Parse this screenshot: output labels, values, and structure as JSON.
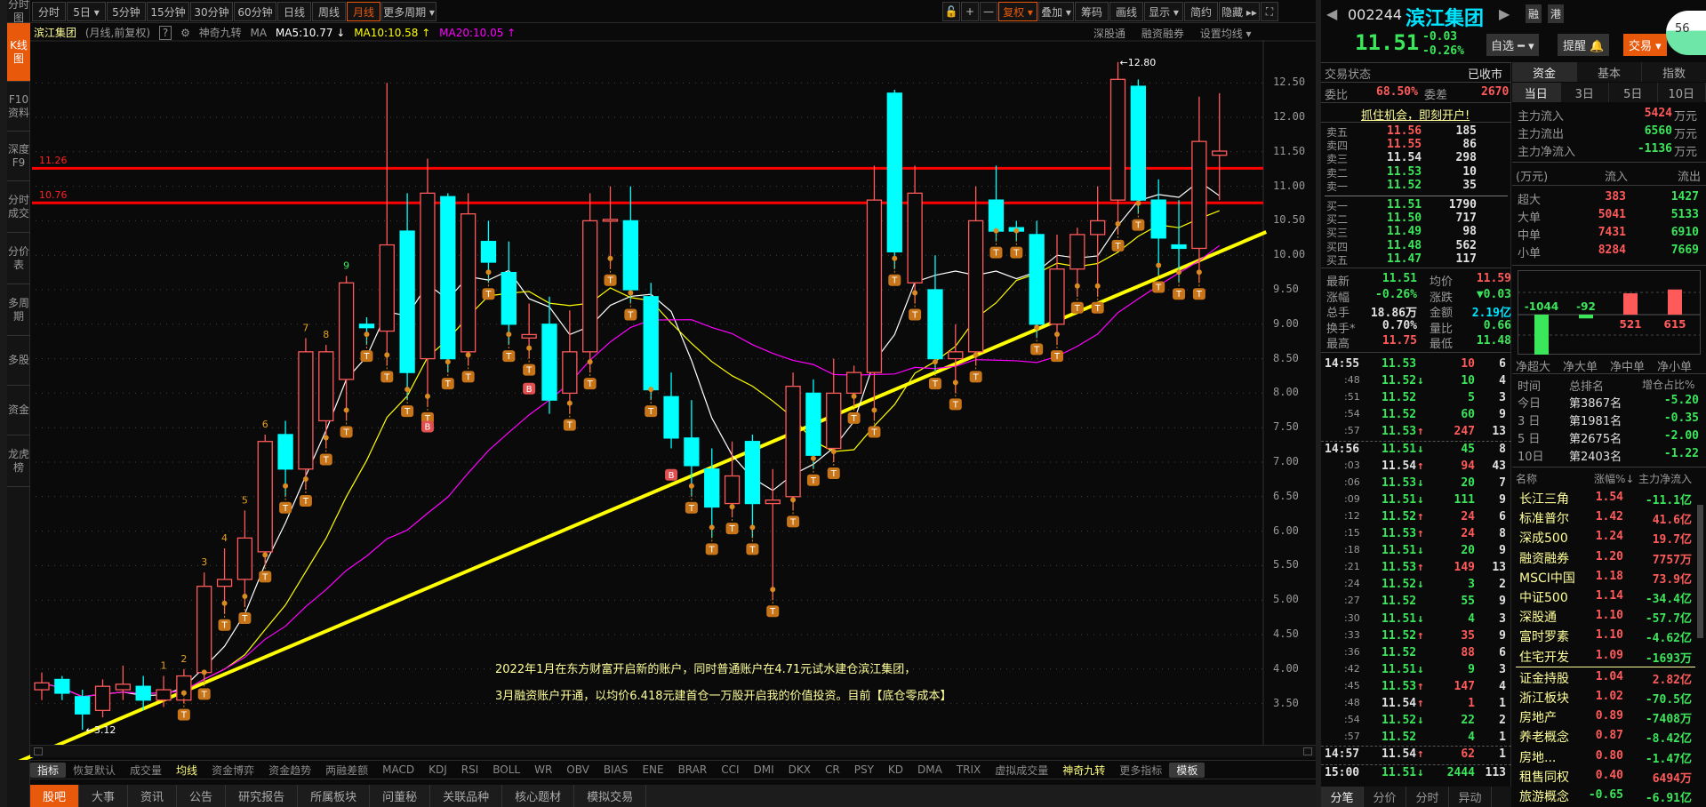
{
  "sidebar": {
    "items": [
      {
        "label": "分时图"
      },
      {
        "label": "K线图",
        "active": true
      },
      {
        "label": "F10资料"
      },
      {
        "label": "深度F9"
      },
      {
        "label": "分时成交"
      },
      {
        "label": "分价表"
      },
      {
        "label": "多周期"
      },
      {
        "label": "多股"
      },
      {
        "label": "资金"
      },
      {
        "label": "龙虎榜"
      }
    ]
  },
  "toolbar": {
    "periods": [
      {
        "label": "分时"
      },
      {
        "label": "5日 ▾"
      },
      {
        "label": "5分钟"
      },
      {
        "label": "15分钟"
      },
      {
        "label": "30分钟"
      },
      {
        "label": "60分钟"
      },
      {
        "label": "日线"
      },
      {
        "label": "周线"
      },
      {
        "label": "月线",
        "active": true
      },
      {
        "label": "更多周期 ▾"
      }
    ],
    "tools": [
      {
        "label": "🔓"
      },
      {
        "label": "+"
      },
      {
        "label": "—"
      },
      {
        "label": "复权 ▾",
        "active": true
      },
      {
        "label": "叠加 ▾"
      },
      {
        "label": "筹码"
      },
      {
        "label": "画线"
      },
      {
        "label": "显示 ▾"
      },
      {
        "label": "简约"
      },
      {
        "label": "隐藏 ▸▸"
      },
      {
        "label": "⛶"
      }
    ]
  },
  "legend": {
    "name": "滨江集团",
    "mode": "(月线,前复权)",
    "help": "?",
    "indicator": "神奇九转",
    "ma": "MA",
    "ma5": "MA5:10.77 ↓",
    "ma10": "MA10:10.58 ↑",
    "ma20": "MA20:10.05 ↑"
  },
  "chart_links": {
    "sgt": "深股通",
    "rzrq": "融资融券",
    "setma": "设置均线 ▾"
  },
  "colors": {
    "up": "#ff5a5a",
    "down": "#00ffff",
    "ma5": "#ffffff",
    "ma10": "#ffff00",
    "ma20": "#ff00ff",
    "accent": "#e8590c",
    "green": "#3ce65a"
  },
  "chart_data": {
    "type": "candlestick",
    "ylim": [
      3.2,
      12.9
    ],
    "yticks": [
      "12.50",
      "12.00",
      "11.50",
      "11.00",
      "10.50",
      "10.00",
      "9.50",
      "9.00",
      "8.50",
      "8.00",
      "7.50",
      "7.00",
      "6.50",
      "6.00",
      "5.50",
      "5.00",
      "4.50",
      "4.00",
      "3.50"
    ],
    "ohlc": [
      [
        3.7,
        3.95,
        3.55,
        3.8
      ],
      [
        3.85,
        3.9,
        3.55,
        3.65
      ],
      [
        3.6,
        3.7,
        3.12,
        3.35
      ],
      [
        3.4,
        3.85,
        3.3,
        3.75
      ],
      [
        3.7,
        4.05,
        3.55,
        3.78
      ],
      [
        3.75,
        3.9,
        3.4,
        3.55
      ],
      [
        3.55,
        3.9,
        3.45,
        3.7
      ],
      [
        3.55,
        4.0,
        3.5,
        3.9
      ],
      [
        3.95,
        5.4,
        3.8,
        5.2
      ],
      [
        5.2,
        5.75,
        4.8,
        5.3
      ],
      [
        5.3,
        6.3,
        4.9,
        5.9
      ],
      [
        5.7,
        7.4,
        5.5,
        7.3
      ],
      [
        7.4,
        7.6,
        6.5,
        6.9
      ],
      [
        6.9,
        8.8,
        6.6,
        8.6
      ],
      [
        7.6,
        8.7,
        7.2,
        8.6
      ],
      [
        8.2,
        9.7,
        7.6,
        9.6
      ],
      [
        9.0,
        9.1,
        8.7,
        8.95
      ],
      [
        8.9,
        12.5,
        8.4,
        10.15
      ],
      [
        10.35,
        10.9,
        7.9,
        8.3
      ],
      [
        8.5,
        11.4,
        7.8,
        10.9
      ],
      [
        10.85,
        10.9,
        8.3,
        8.5
      ],
      [
        8.6,
        10.9,
        8.4,
        10.6
      ],
      [
        10.2,
        10.5,
        9.6,
        9.9
      ],
      [
        9.75,
        10.2,
        8.7,
        9.0
      ],
      [
        8.8,
        9.3,
        8.5,
        8.85
      ],
      [
        9.0,
        9.4,
        7.7,
        7.9
      ],
      [
        8.0,
        9.2,
        7.7,
        8.6
      ],
      [
        8.6,
        10.9,
        8.3,
        10.5
      ],
      [
        10.5,
        11.0,
        9.8,
        10.52
      ],
      [
        10.5,
        11.0,
        9.3,
        9.5
      ],
      [
        9.4,
        9.6,
        7.9,
        8.05
      ],
      [
        7.95,
        8.3,
        7.2,
        7.35
      ],
      [
        7.35,
        7.9,
        6.5,
        6.95
      ],
      [
        6.9,
        7.2,
        5.9,
        6.35
      ],
      [
        6.4,
        7.3,
        6.2,
        6.8
      ],
      [
        7.3,
        7.4,
        5.9,
        6.4
      ],
      [
        6.4,
        6.9,
        5.0,
        6.45
      ],
      [
        6.5,
        8.3,
        6.3,
        8.1
      ],
      [
        8.0,
        8.2,
        6.9,
        7.1
      ],
      [
        7.2,
        8.5,
        7.0,
        8.0
      ],
      [
        8.0,
        8.4,
        7.8,
        8.3
      ],
      [
        8.3,
        11.3,
        7.6,
        10.8
      ],
      [
        12.35,
        12.4,
        9.8,
        10.05
      ],
      [
        9.6,
        11.3,
        9.3,
        10.9
      ],
      [
        9.5,
        10.0,
        8.3,
        8.5
      ],
      [
        8.5,
        9.0,
        8.0,
        8.6
      ],
      [
        8.6,
        11.0,
        8.4,
        10.5
      ],
      [
        10.8,
        11.3,
        10.2,
        10.35
      ],
      [
        10.4,
        10.5,
        10.2,
        10.35
      ],
      [
        10.3,
        10.5,
        8.8,
        9.0
      ],
      [
        9.0,
        10.3,
        8.7,
        9.8
      ],
      [
        9.8,
        10.4,
        9.4,
        10.3
      ],
      [
        10.3,
        11.0,
        9.4,
        10.5
      ],
      [
        10.8,
        12.8,
        10.3,
        12.55
      ],
      [
        12.45,
        12.55,
        10.6,
        10.8
      ],
      [
        10.8,
        11.1,
        9.7,
        10.25
      ],
      [
        10.15,
        10.8,
        9.6,
        10.1
      ],
      [
        10.1,
        12.3,
        9.6,
        11.65
      ],
      [
        11.45,
        12.35,
        10.8,
        11.51
      ]
    ],
    "hlines": [
      {
        "label": "11.26",
        "value": 11.26
      },
      {
        "label": "10.76",
        "value": 10.76
      }
    ],
    "trendline": [
      [
        2,
        3.05
      ],
      [
        58,
        10.05
      ]
    ],
    "annotations": {
      "high": "←12.80",
      "low": "←3.12"
    },
    "nine_counts": [
      {
        "i": 6,
        "label": "1"
      },
      {
        "i": 7,
        "label": "2"
      },
      {
        "i": 8,
        "label": "3"
      },
      {
        "i": 9,
        "label": "4"
      },
      {
        "i": 10,
        "label": "5"
      },
      {
        "i": 11,
        "label": "6"
      },
      {
        "i": 13,
        "label": "7"
      },
      {
        "i": 14,
        "label": "8"
      },
      {
        "i": 15,
        "label": "9"
      }
    ],
    "t_markers": [
      7,
      8,
      9,
      10,
      11,
      12,
      13,
      14,
      15,
      16,
      17,
      18,
      19,
      20,
      21,
      22,
      23,
      24,
      26,
      27,
      28,
      29,
      30,
      32,
      33,
      34,
      35,
      36,
      37,
      38,
      39,
      40,
      41,
      42,
      43,
      44,
      45,
      46,
      47,
      48,
      49,
      50,
      51,
      52,
      53,
      54,
      55,
      56,
      57
    ],
    "t_label": "T",
    "b_markers": [
      {
        "i": 19,
        "p": 7.6
      },
      {
        "i": 24,
        "p": 8.15
      },
      {
        "i": 31,
        "p": 6.9
      }
    ],
    "b_label": "B"
  },
  "note": {
    "line1": "2022年1月在东方财富开启新的账户，同时普通账户在4.71元试水建仓滨江集团，",
    "line2": "3月融资账户开通，以均价6.418元建首仓一万股开启我的价值投资。目前【底仓零成本】"
  },
  "indicators": [
    {
      "label": "指标",
      "box": true
    },
    {
      "label": "恢复默认"
    },
    {
      "label": "成交量"
    },
    {
      "label": "均线",
      "hl": true
    },
    {
      "label": "资金博弈"
    },
    {
      "label": "资金趋势"
    },
    {
      "label": "两融差额"
    },
    {
      "label": "MACD"
    },
    {
      "label": "KDJ"
    },
    {
      "label": "RSI"
    },
    {
      "label": "BOLL"
    },
    {
      "label": "WR"
    },
    {
      "label": "OBV"
    },
    {
      "label": "BIAS"
    },
    {
      "label": "ENE"
    },
    {
      "label": "BRAR"
    },
    {
      "label": "CCI"
    },
    {
      "label": "DMI"
    },
    {
      "label": "DKX"
    },
    {
      "label": "CR"
    },
    {
      "label": "PSY"
    },
    {
      "label": "KD"
    },
    {
      "label": "DMA"
    },
    {
      "label": "TRIX"
    },
    {
      "label": "虚拟成交量"
    },
    {
      "label": "神奇九转",
      "hl": true
    },
    {
      "label": "更多指标"
    },
    {
      "label": "模板",
      "box": true
    }
  ],
  "bottom_tabs": [
    {
      "label": "股吧",
      "active": true
    },
    {
      "label": "大事"
    },
    {
      "label": "资讯"
    },
    {
      "label": "公告"
    },
    {
      "label": "研究报告"
    },
    {
      "label": "所属板块"
    },
    {
      "label": "问董秘"
    },
    {
      "label": "关联品种"
    },
    {
      "label": "核心题材"
    },
    {
      "label": "模拟交易"
    }
  ],
  "quote": {
    "code": "002244",
    "name": "滨江集团",
    "tag1": "融",
    "tag2": "港",
    "price": "11.51",
    "change": "-0.03",
    "pct": "-0.26%",
    "watch": "自选 ━ ▾",
    "alert": "提醒 🔔",
    "trade": "交易 ▾",
    "badge": "56"
  },
  "book": {
    "status_label": "交易状态",
    "status": "已收市",
    "wb_label": "委比",
    "wb": "68.50%",
    "wc_label": "委差",
    "wc": "2670",
    "promo": "抓住机会，即刻开户!",
    "asks": [
      {
        "l": "卖五",
        "p": "11.56",
        "v": "185",
        "c": "red"
      },
      {
        "l": "卖四",
        "p": "11.55",
        "v": "86",
        "c": "red"
      },
      {
        "l": "卖三",
        "p": "11.54",
        "v": "298",
        "c": "white"
      },
      {
        "l": "卖二",
        "p": "11.53",
        "v": "10",
        "c": "green"
      },
      {
        "l": "卖一",
        "p": "11.52",
        "v": "35",
        "c": "green"
      }
    ],
    "bids": [
      {
        "l": "买一",
        "p": "11.51",
        "v": "1790",
        "c": "green"
      },
      {
        "l": "买二",
        "p": "11.50",
        "v": "717",
        "c": "green"
      },
      {
        "l": "买三",
        "p": "11.49",
        "v": "98",
        "c": "green"
      },
      {
        "l": "买四",
        "p": "11.48",
        "v": "562",
        "c": "green"
      },
      {
        "l": "买五",
        "p": "11.47",
        "v": "117",
        "c": "green"
      }
    ],
    "stats": [
      [
        {
          "l": "最新",
          "v": "11.51",
          "c": "green"
        },
        {
          "l": "均价",
          "v": "11.59",
          "c": "red"
        }
      ],
      [
        {
          "l": "涨幅",
          "v": "-0.26%",
          "c": "green"
        },
        {
          "l": "涨跌",
          "v": "▼0.03",
          "c": "green"
        }
      ],
      [
        {
          "l": "总手",
          "v": "18.86万",
          "c": "white"
        },
        {
          "l": "金额",
          "v": "2.19亿",
          "c": "cyan"
        }
      ],
      [
        {
          "l": "换手*",
          "v": "0.70%",
          "c": "white"
        },
        {
          "l": "量比",
          "v": "0.66",
          "c": "green"
        }
      ],
      [
        {
          "l": "最高",
          "v": "11.75",
          "c": "red"
        },
        {
          "l": "最低",
          "v": "11.48",
          "c": "green"
        }
      ]
    ]
  },
  "ticks": [
    {
      "t": "14:55",
      "p": "11.53",
      "a": "",
      "v": "10",
      "vc": "red",
      "n": "6",
      "pc": "green",
      "major": true
    },
    {
      "t": ":48",
      "p": "11.52",
      "a": "↓",
      "v": "10",
      "vc": "green",
      "n": "4",
      "pc": "green"
    },
    {
      "t": ":51",
      "p": "11.52",
      "a": "",
      "v": "5",
      "vc": "green",
      "n": "3",
      "pc": "green"
    },
    {
      "t": ":54",
      "p": "11.52",
      "a": "",
      "v": "60",
      "vc": "green",
      "n": "9",
      "pc": "green"
    },
    {
      "t": ":57",
      "p": "11.53",
      "a": "↑",
      "v": "247",
      "vc": "red",
      "n": "13",
      "pc": "green"
    },
    {
      "t": "14:56",
      "p": "11.51",
      "a": "↓",
      "v": "45",
      "vc": "green",
      "n": "8",
      "pc": "green",
      "major": true,
      "sep": true
    },
    {
      "t": ":03",
      "p": "11.54",
      "a": "↑",
      "v": "94",
      "vc": "red",
      "n": "43",
      "pc": "white"
    },
    {
      "t": ":06",
      "p": "11.53",
      "a": "↓",
      "v": "20",
      "vc": "green",
      "n": "7",
      "pc": "green"
    },
    {
      "t": ":09",
      "p": "11.51",
      "a": "↓",
      "v": "111",
      "vc": "green",
      "n": "9",
      "pc": "green"
    },
    {
      "t": ":12",
      "p": "11.52",
      "a": "↑",
      "v": "24",
      "vc": "red",
      "n": "6",
      "pc": "green"
    },
    {
      "t": ":15",
      "p": "11.53",
      "a": "↑",
      "v": "24",
      "vc": "red",
      "n": "8",
      "pc": "green"
    },
    {
      "t": ":18",
      "p": "11.51",
      "a": "↓",
      "v": "20",
      "vc": "green",
      "n": "9",
      "pc": "green"
    },
    {
      "t": ":21",
      "p": "11.53",
      "a": "↑",
      "v": "149",
      "vc": "red",
      "n": "13",
      "pc": "green"
    },
    {
      "t": ":24",
      "p": "11.52",
      "a": "↓",
      "v": "3",
      "vc": "green",
      "n": "2",
      "pc": "green"
    },
    {
      "t": ":27",
      "p": "11.52",
      "a": "",
      "v": "55",
      "vc": "green",
      "n": "9",
      "pc": "green"
    },
    {
      "t": ":30",
      "p": "11.51",
      "a": "↓",
      "v": "4",
      "vc": "green",
      "n": "3",
      "pc": "green"
    },
    {
      "t": ":33",
      "p": "11.52",
      "a": "↑",
      "v": "35",
      "vc": "red",
      "n": "9",
      "pc": "green"
    },
    {
      "t": ":36",
      "p": "11.52",
      "a": "",
      "v": "88",
      "vc": "red",
      "n": "6",
      "pc": "green"
    },
    {
      "t": ":42",
      "p": "11.51",
      "a": "↓",
      "v": "9",
      "vc": "green",
      "n": "3",
      "pc": "green"
    },
    {
      "t": ":45",
      "p": "11.53",
      "a": "↑",
      "v": "147",
      "vc": "red",
      "n": "4",
      "pc": "green"
    },
    {
      "t": ":48",
      "p": "11.54",
      "a": "↑",
      "v": "1",
      "vc": "red",
      "n": "1",
      "pc": "white"
    },
    {
      "t": ":54",
      "p": "11.52",
      "a": "↓",
      "v": "22",
      "vc": "green",
      "n": "2",
      "pc": "green"
    },
    {
      "t": ":57",
      "p": "11.52",
      "a": "",
      "v": "4",
      "vc": "green",
      "n": "1",
      "pc": "green"
    },
    {
      "t": "14:57",
      "p": "11.54",
      "a": "↑",
      "v": "62",
      "vc": "red",
      "n": "1",
      "pc": "white",
      "major": true,
      "sep": true
    },
    {
      "t": "15:00",
      "p": "11.51",
      "a": "↓",
      "v": "2444",
      "vc": "green",
      "n": "113",
      "pc": "green",
      "major": true,
      "sep": true
    }
  ],
  "tick_tabs": [
    {
      "label": "分笔",
      "active": true
    },
    {
      "label": "分价"
    },
    {
      "label": "分时"
    },
    {
      "label": "异动"
    }
  ],
  "funds": {
    "tabs": [
      {
        "label": "资金",
        "active": true
      },
      {
        "label": "基本"
      },
      {
        "label": "指数"
      }
    ],
    "periods": [
      {
        "label": "当日",
        "active": true
      },
      {
        "label": "3日"
      },
      {
        "label": "5日"
      },
      {
        "label": "10日"
      }
    ],
    "main": [
      {
        "l": "主力流入",
        "v": "5424",
        "u": "万元",
        "c": "red"
      },
      {
        "l": "主力流出",
        "v": "6560",
        "u": "万元",
        "c": "green"
      },
      {
        "l": "主力净流入",
        "v": "-1136",
        "u": "万元",
        "c": "green"
      }
    ],
    "head": {
      "unit": "(万元)",
      "in": "流入",
      "out": "流出"
    },
    "rows": [
      {
        "l": "超大",
        "in": "383",
        "out": "1427"
      },
      {
        "l": "大单",
        "in": "5041",
        "out": "5133"
      },
      {
        "l": "中单",
        "in": "7431",
        "out": "6910"
      },
      {
        "l": "小单",
        "in": "8284",
        "out": "7669"
      }
    ],
    "net": [
      {
        "l": "净超大",
        "v": -1044,
        "s": "-1044"
      },
      {
        "l": "净大单",
        "v": -92,
        "s": "-92"
      },
      {
        "l": "净中单",
        "v": 521,
        "s": "521"
      },
      {
        "l": "净小单",
        "v": 615,
        "s": "615"
      }
    ],
    "rank_head": {
      "t": "时间",
      "r": "总排名",
      "p": "增仓占比%"
    },
    "ranks": [
      {
        "t": "今日",
        "r": "第3867名",
        "p": "-5.20"
      },
      {
        "t": "3 日",
        "r": "第1981名",
        "p": "-0.35"
      },
      {
        "t": "5 日",
        "r": "第2675名",
        "p": "-2.00"
      },
      {
        "t": "10日",
        "r": "第2403名",
        "p": "-1.22"
      }
    ]
  },
  "sectors": {
    "head": {
      "n": "名称",
      "p": "涨幅%↓",
      "f": "主力净流入"
    },
    "rows": [
      {
        "n": "长江三角",
        "p": "1.54",
        "f": "-11.1亿"
      },
      {
        "n": "标准普尔",
        "p": "1.42",
        "f": "41.6亿"
      },
      {
        "n": "深成500",
        "p": "1.24",
        "f": "19.7亿"
      },
      {
        "n": "融资融券",
        "p": "1.20",
        "f": "7757万"
      },
      {
        "n": "MSCI中国",
        "p": "1.18",
        "f": "73.9亿"
      },
      {
        "n": "中证500",
        "p": "1.14",
        "f": "-34.4亿"
      },
      {
        "n": "深股通",
        "p": "1.10",
        "f": "-57.7亿"
      },
      {
        "n": "富时罗素",
        "p": "1.10",
        "f": "-4.62亿"
      },
      {
        "n": "住宅开发",
        "p": "1.09",
        "f": "-1693万"
      },
      {
        "n": "证金持股",
        "p": "1.04",
        "f": "2.82亿"
      },
      {
        "n": "浙江板块",
        "p": "1.02",
        "f": "-70.5亿"
      },
      {
        "n": "房地产",
        "p": "0.89",
        "f": "-7408万"
      },
      {
        "n": "养老概念",
        "p": "0.87",
        "f": "-8.42亿"
      },
      {
        "n": "房地...",
        "p": "0.80",
        "f": "-1.47亿"
      },
      {
        "n": "租售同权",
        "p": "0.40",
        "f": "6494万"
      },
      {
        "n": "旅游概念",
        "p": "-0.65",
        "f": "-6.91亿"
      }
    ]
  }
}
